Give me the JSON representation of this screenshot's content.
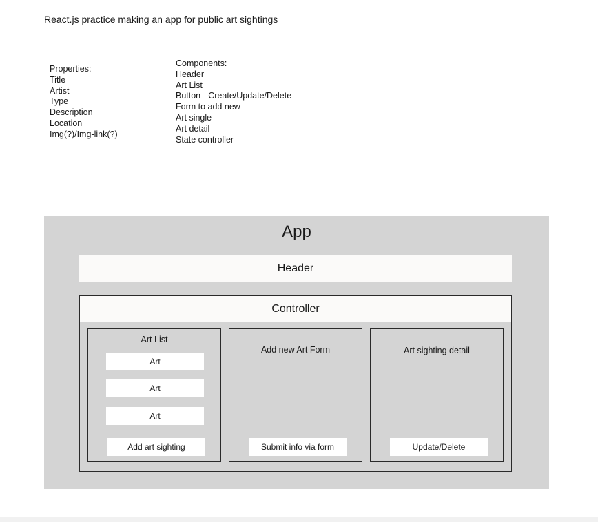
{
  "title": "React.js practice making an app for public art sightings",
  "properties": [
    "Properties:",
    "Title",
    "Artist",
    "Type",
    "Description",
    "Location",
    "Img(?)/Img-link(?)"
  ],
  "components": [
    "Components:",
    "Header",
    "Art List",
    "Button - Create/Update/Delete",
    "Form to add new",
    "Art single",
    "Art detail",
    "State controller"
  ],
  "diagram": {
    "app_label": "App",
    "header_label": "Header",
    "controller_label": "Controller",
    "art_list": {
      "title": "Art List",
      "items": [
        "Art",
        "Art",
        "Art"
      ],
      "button": "Add art sighting"
    },
    "form": {
      "title": "Add new Art Form",
      "button": "Submit info via form"
    },
    "detail": {
      "title": "Art sighting detail",
      "button": "Update/Delete"
    }
  },
  "colors": {
    "frame": "#d4d4d4",
    "box": "#fbfaf9",
    "border": "#2a2a2a"
  }
}
